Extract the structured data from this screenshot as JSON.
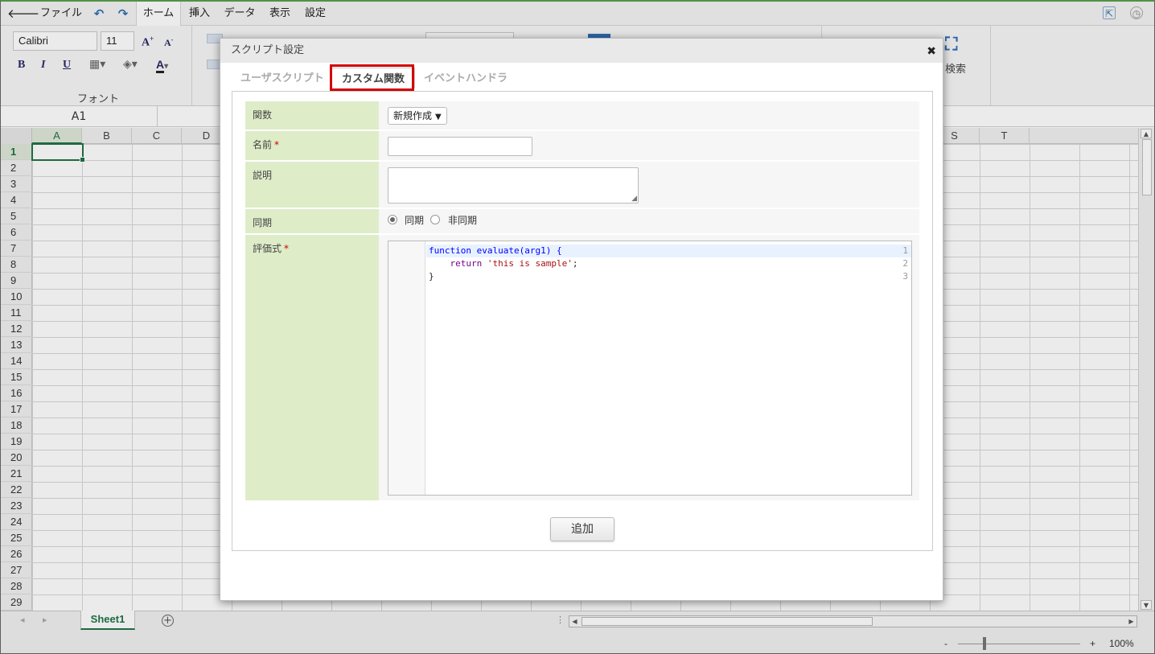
{
  "menu": {
    "back_icon": "back-arrow-icon",
    "file": "ファイル",
    "undo_icon": "undo-icon",
    "redo_icon": "redo-icon",
    "home": "ホーム",
    "insert": "挿入",
    "data": "データ",
    "view": "表示",
    "settings": "設定"
  },
  "ribbon": {
    "font_name": "Calibri",
    "font_size": "11",
    "bold": "B",
    "italic": "I",
    "underline": "U",
    "font_group_label": "フォント",
    "search_label": "検索"
  },
  "namebox": "A1",
  "columns": [
    "A",
    "B",
    "C",
    "D",
    "",
    "",
    "",
    "",
    "",
    "",
    "",
    "",
    "",
    "",
    "",
    "",
    "",
    "",
    "S",
    "T"
  ],
  "rows": [
    "1",
    "2",
    "3",
    "4",
    "5",
    "6",
    "7",
    "8",
    "9",
    "10",
    "11",
    "12",
    "13",
    "14",
    "15",
    "16",
    "17",
    "18",
    "19",
    "20",
    "21",
    "22",
    "23",
    "24",
    "25",
    "26",
    "27",
    "28",
    "29"
  ],
  "sheets": {
    "active": "Sheet1"
  },
  "status": {
    "zoom_minus": "-",
    "zoom_plus": "+",
    "zoom": "100%"
  },
  "dialog": {
    "title": "スクリプト設定",
    "close": "✖",
    "tabs": [
      {
        "label": "ユーザスクリプト"
      },
      {
        "label": "カスタム関数"
      },
      {
        "label": "イベントハンドラ"
      }
    ],
    "fields": {
      "function_label": "関数",
      "function_value": "新規作成",
      "name_label": "名前",
      "description_label": "説明",
      "sync_label": "同期",
      "sync_option": "同期",
      "async_option": "非同期",
      "expression_label": "評価式",
      "required_mark": "*"
    },
    "code_lines": [
      {
        "n": "1",
        "kw": "function",
        "fn": " evaluate",
        "rest": "(arg1) {"
      },
      {
        "n": "2",
        "pre": "    ",
        "kw": "return",
        "str": " 'this is sample'",
        "rest": ";"
      },
      {
        "n": "3",
        "rest": "}"
      }
    ],
    "add_button": "追加"
  }
}
